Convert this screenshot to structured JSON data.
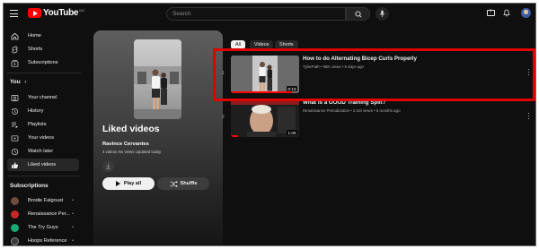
{
  "app": {
    "name": "YouTube",
    "country": "NO"
  },
  "search": {
    "placeholder": "Search"
  },
  "sidebar": {
    "main": [
      {
        "label": "Home",
        "icon": "home-icon"
      },
      {
        "label": "Shorts",
        "icon": "shorts-icon"
      },
      {
        "label": "Subscriptions",
        "icon": "subscriptions-icon"
      }
    ],
    "you_title": "You",
    "you_chevron": "›",
    "you": [
      {
        "label": "Your channel",
        "icon": "channel-icon"
      },
      {
        "label": "History",
        "icon": "history-icon"
      },
      {
        "label": "Playlists",
        "icon": "playlists-icon"
      },
      {
        "label": "Your videos",
        "icon": "your-videos-icon"
      },
      {
        "label": "Watch later",
        "icon": "clock-icon"
      },
      {
        "label": "Liked videos",
        "icon": "thumbs-up-icon",
        "active": true
      }
    ],
    "subs_title": "Subscriptions",
    "subs": [
      {
        "label": "Brodie Falgoust",
        "color": "#6d4c3d"
      },
      {
        "label": "Renaissance Per...",
        "color": "#c62828"
      },
      {
        "label": "The Try Guys",
        "color": "#19a974"
      },
      {
        "label": "Hoops Reference",
        "color": "#3b3b3b"
      }
    ],
    "sub_dot": "•"
  },
  "playlist": {
    "title": "Liked videos",
    "owner": "Ravince Cervantes",
    "meta": "4 videos  No views  Updated today",
    "play_all": "Play all",
    "shuffle": "Shuffle"
  },
  "chips": [
    "All",
    "Videos",
    "Shorts"
  ],
  "videos": [
    {
      "index": "1",
      "title": "How to do Alternating Bicep Curls Properly",
      "meta": "TylerPath • 95K views • 5 days ago",
      "duration": "0:13",
      "progress": 0.9
    },
    {
      "index": "2",
      "title": "What is a GOOD Training Split?",
      "meta": "Renaissance Periodization • 2.1M views • 6 months ago",
      "duration": "1:00",
      "progress": 0.1
    }
  ],
  "colors": {
    "accent": "#ff0000",
    "background": "#0f0f0f",
    "highlight": "#e00000"
  }
}
